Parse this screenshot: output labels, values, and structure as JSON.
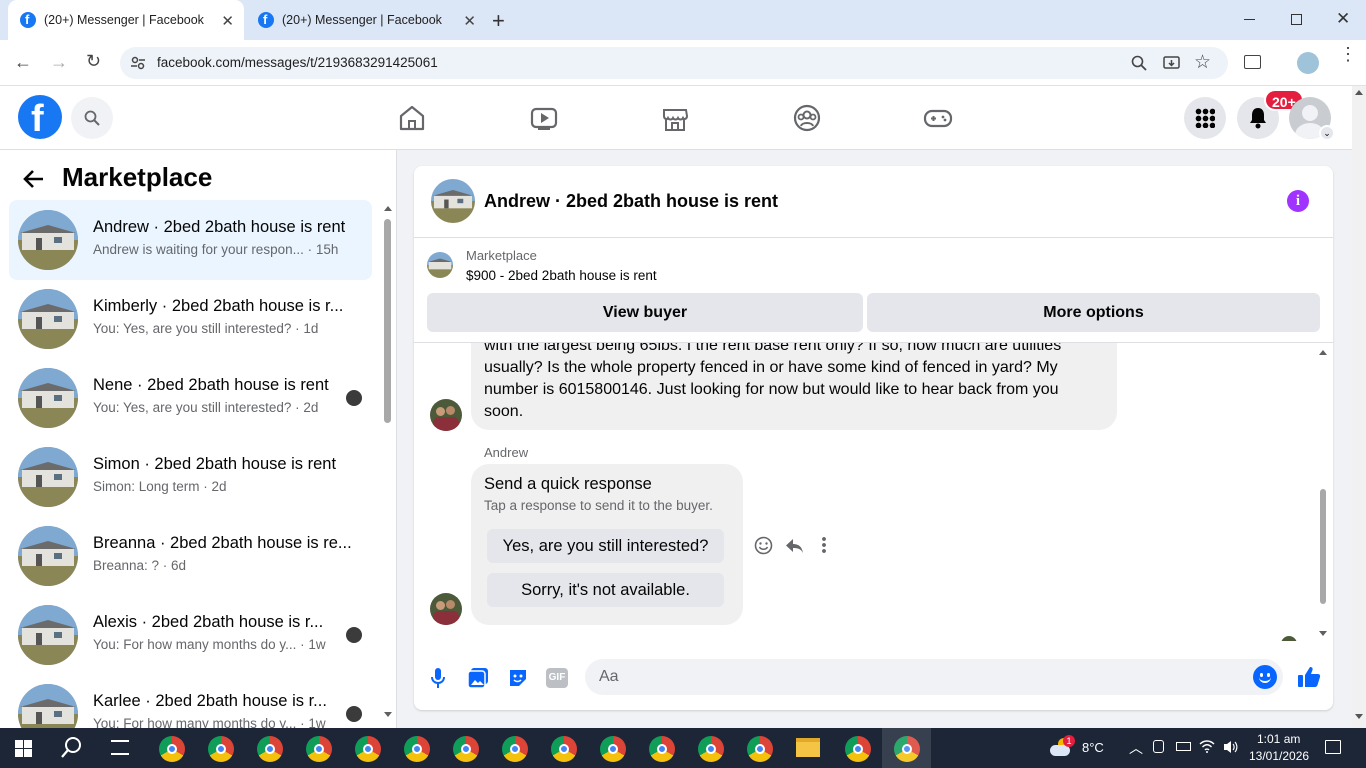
{
  "browser": {
    "tabs": [
      {
        "title": "(20+) Messenger | Facebook"
      },
      {
        "title": "(20+) Messenger | Facebook"
      }
    ],
    "url": "facebook.com/messages/t/2193683291425061"
  },
  "header": {
    "notification_badge": "20+"
  },
  "sidebar": {
    "title": "Marketplace",
    "conversations": [
      {
        "name": "Andrew · 2bed 2bath house is rent",
        "preview": "Andrew is waiting for your respon... · 15h"
      },
      {
        "name": "Kimberly · 2bed 2bath house is r...",
        "preview": "You: Yes, are you still interested? · 1d"
      },
      {
        "name": "Nene · 2bed 2bath house is rent",
        "preview": "You: Yes, are you still interested? · 2d"
      },
      {
        "name": "Simon · 2bed 2bath house is rent",
        "preview": "Simon: Long term · 2d"
      },
      {
        "name": "Breanna · 2bed 2bath house is re...",
        "preview": "Breanna: ? · 6d"
      },
      {
        "name": "Alexis · 2bed 2bath house is r...",
        "preview": "You: For how many months do y... · 1w"
      },
      {
        "name": "Karlee · 2bed 2bath house is r...",
        "preview": "You: For how many months do y... · 1w"
      }
    ]
  },
  "chat": {
    "title": "Andrew · 2bed 2bath house is rent",
    "listing_label": "Marketplace",
    "listing_price": "$900 - 2bed 2bath house is rent",
    "view_buyer_label": "View buyer",
    "more_options_label": "More options",
    "message_lines": [
      "with the largest being 65lbs. I the rent base rent only? If so, how much are utilities",
      "usually? Is the whole property fenced in or have some kind of fenced in yard? My",
      "number is 6015800146. Just looking for now but would like to hear back from you",
      "soon."
    ],
    "sender_name": "Andrew",
    "quick_title": "Send a quick response",
    "quick_subtitle": "Tap a response to send it to the buyer.",
    "quick_options": [
      "Yes, are you still interested?",
      "Sorry, it's not available."
    ],
    "input_placeholder": "Aa"
  },
  "taskbar": {
    "weather_temp": "8°C",
    "weather_badge": "1",
    "time": "1:01 am",
    "date": "13/01/2026"
  },
  "colors": {
    "brand": "#1877f2",
    "badge": "#e41e3f",
    "info": "#a033ff",
    "taskbar": "#1c2636"
  }
}
